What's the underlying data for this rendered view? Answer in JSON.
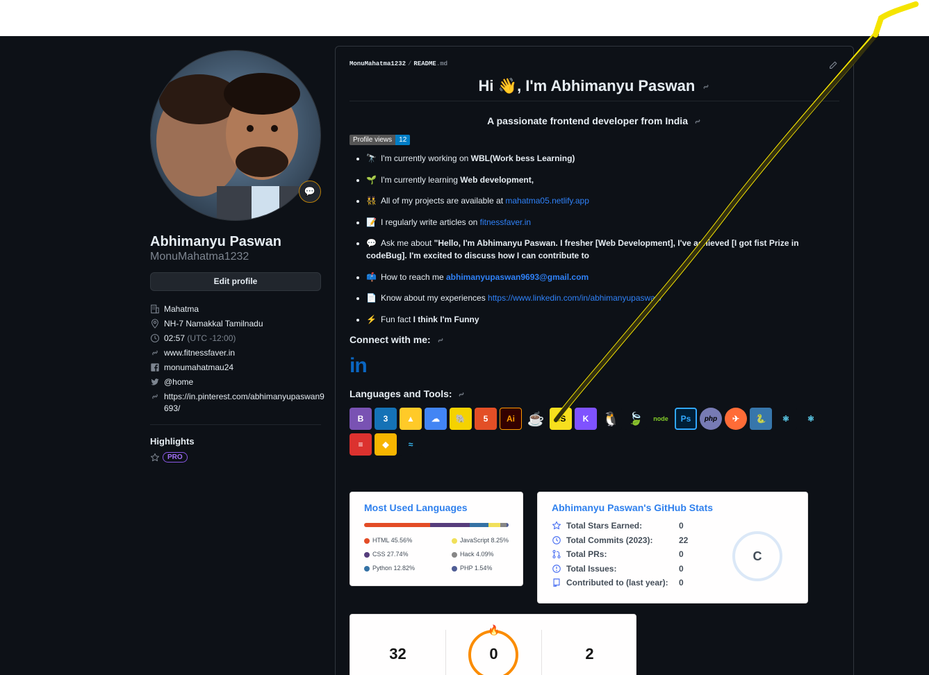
{
  "profile": {
    "full_name": "Abhimanyu Paswan",
    "login": "MonuMahatma1232",
    "edit_label": "Edit profile",
    "status_icon": "speech-bubble-icon",
    "company": "Mahatma",
    "location": "NH-7 Namakkal Tamilnadu",
    "time": "02:57",
    "timezone": "(UTC -12:00)",
    "website": "www.fitnessfaver.in",
    "facebook": "monumahatmau24",
    "twitter": "@home",
    "pinterest_line1": "https://in.pinterest.com/abhimanyupaswan9",
    "pinterest_line2": "693/",
    "highlights_title": "Highlights",
    "pro_label": "PRO"
  },
  "readme": {
    "crumb_owner": "MonuMahatma1232",
    "crumb_sep": "/",
    "crumb_file": "README",
    "crumb_ext": ".md",
    "heading_pre": "Hi ",
    "heading_emoji": "👋",
    "heading_post": ", I'm Abhimanyu Paswan",
    "subtitle": "A passionate frontend developer from India",
    "badge_label": "Profile views",
    "badge_value": "12",
    "facts": [
      {
        "emoji": "🔭",
        "text": "I'm currently working on ",
        "bold": "WBL(Work bess Learning)"
      },
      {
        "emoji": "🌱",
        "text": "I'm currently learning ",
        "bold": "Web development,"
      },
      {
        "emoji": "👯",
        "text": "All of my projects are available at ",
        "link": "mahatma05.netlify.app"
      },
      {
        "emoji": "📝",
        "text": "I regularly write articles on ",
        "link": "fitnessfaver.in"
      },
      {
        "emoji": "💬",
        "text": "Ask me about ",
        "bold": "\"Hello, I'm Abhimanyu Paswan. I fresher [Web Development], I've achieved [I got fist Prize in codeBug]. I'm excited to discuss how I can contribute to"
      },
      {
        "emoji": "📫",
        "text": "How to reach me ",
        "boldlink": "abhimanyupaswan9693@gmail.com"
      },
      {
        "emoji": "📄",
        "text": "Know about my experiences ",
        "link": "https://www.linkedin.com/in/abhimanyupaswan/"
      },
      {
        "emoji": "⚡",
        "text": "Fun fact ",
        "bold": "I think I'm Funny"
      }
    ],
    "connect_title": "Connect with me:",
    "linkedin_logo": "in",
    "tools_title": "Languages and Tools:",
    "tools": [
      {
        "name": "bootstrap",
        "glyph": "B",
        "color": "#7952b3"
      },
      {
        "name": "css3",
        "glyph": "3",
        "color": "#1572b6"
      },
      {
        "name": "firebase",
        "glyph": "▲",
        "color": "#ffca28"
      },
      {
        "name": "gcp",
        "glyph": "☁",
        "color": "#4285f4"
      },
      {
        "name": "hadoop",
        "glyph": "🐘",
        "color": "#f5d200"
      },
      {
        "name": "html5",
        "glyph": "5",
        "color": "#e34f26"
      },
      {
        "name": "illustrator",
        "glyph": "Ai",
        "color": "#330000"
      },
      {
        "name": "java",
        "glyph": "☕",
        "color": "#0d1117"
      },
      {
        "name": "javascript",
        "glyph": "JS",
        "color": "#f7df1e"
      },
      {
        "name": "kotlin",
        "glyph": "K",
        "color": "#7f52ff"
      },
      {
        "name": "linux",
        "glyph": "🐧",
        "color": "#0d1117"
      },
      {
        "name": "mongodb",
        "glyph": "🍃",
        "color": "#0d1117"
      },
      {
        "name": "nodejs",
        "glyph": "node",
        "color": "#0d1117"
      },
      {
        "name": "photoshop",
        "glyph": "Ps",
        "color": "#001e36"
      },
      {
        "name": "php",
        "glyph": "php",
        "color": "#777bb4"
      },
      {
        "name": "postman",
        "glyph": "✈",
        "color": "#ff6c37"
      },
      {
        "name": "python",
        "glyph": "🐍",
        "color": "#3776ab"
      },
      {
        "name": "react",
        "glyph": "⚛",
        "color": "#0d1117"
      },
      {
        "name": "reactnative",
        "glyph": "⚛",
        "color": "#0d1117"
      },
      {
        "name": "scala",
        "glyph": "≡",
        "color": "#dc322f"
      },
      {
        "name": "sketch",
        "glyph": "◆",
        "color": "#f7b500"
      },
      {
        "name": "tailwind",
        "glyph": "≈",
        "color": "#0d1117"
      }
    ],
    "react_label": "React",
    "nodejs_label": "nodejs",
    "mongodb_label": "mongoDB",
    "bootstrap_label": "Bootstrap"
  },
  "languages_card": {
    "title": "Most Used Languages",
    "items": [
      {
        "name": "HTML",
        "pct": 45.56,
        "label": "HTML 45.56%",
        "color": "#e34c26"
      },
      {
        "name": "CSS",
        "pct": 27.74,
        "label": "CSS 27.74%",
        "color": "#563d7c"
      },
      {
        "name": "Python",
        "pct": 12.82,
        "label": "Python 12.82%",
        "color": "#3572a5"
      },
      {
        "name": "JavaScript",
        "pct": 8.25,
        "label": "JavaScript 8.25%",
        "color": "#f1e05a"
      },
      {
        "name": "Hack",
        "pct": 4.09,
        "label": "Hack 4.09%",
        "color": "#878787"
      },
      {
        "name": "PHP",
        "pct": 1.54,
        "label": "PHP 1.54%",
        "color": "#4f5d95"
      }
    ]
  },
  "github_stats": {
    "title": "Abhimanyu Paswan's GitHub Stats",
    "rows": [
      {
        "label": "Total Stars Earned:",
        "value": "0",
        "icon": "star-icon"
      },
      {
        "label": "Total Commits (2023):",
        "value": "22",
        "icon": "clock-icon"
      },
      {
        "label": "Total PRs:",
        "value": "0",
        "icon": "pull-request-icon"
      },
      {
        "label": "Total Issues:",
        "value": "0",
        "icon": "issue-icon"
      },
      {
        "label": "Contributed to (last year):",
        "value": "0",
        "icon": "repo-icon"
      }
    ],
    "grade": "C"
  },
  "streak": {
    "total_contributions": "32",
    "current_streak": "0",
    "longest_streak": "2",
    "accent": "#fb8c00"
  },
  "colors": {
    "bg": "#0d1117",
    "link": "#2f81f7",
    "border": "#30363d",
    "annotation": "#f5e400"
  }
}
